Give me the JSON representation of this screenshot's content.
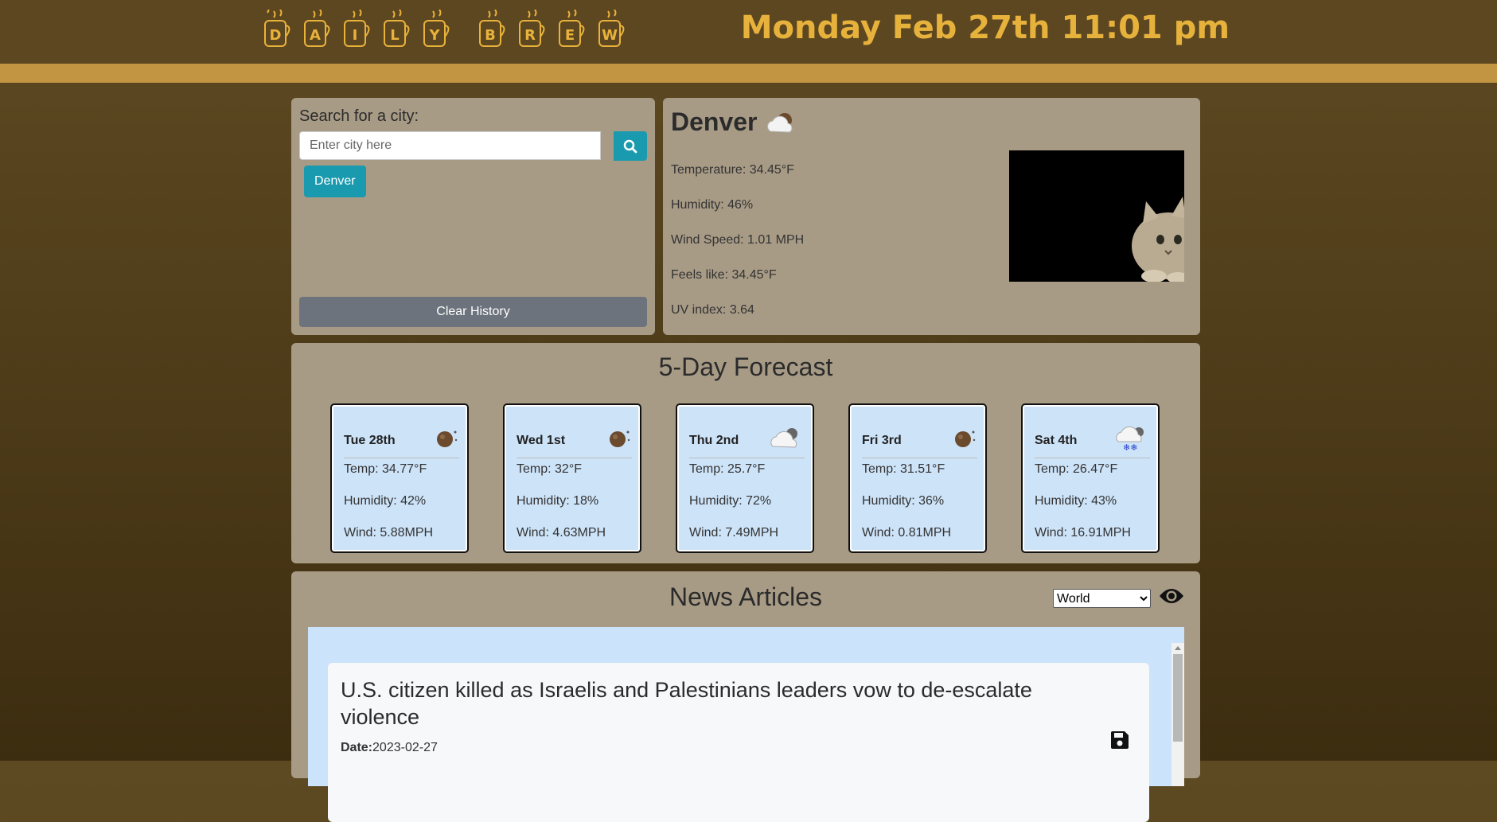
{
  "header": {
    "logo_letters": [
      "D",
      "A",
      "I",
      "L",
      "Y",
      "B",
      "R",
      "E",
      "W"
    ],
    "datetime": "Monday Feb 27th 11:01 pm"
  },
  "search": {
    "label": "Search for a city:",
    "placeholder": "Enter city here",
    "value": "",
    "history": [
      "Denver"
    ],
    "clear_label": "Clear History"
  },
  "current": {
    "city": "Denver",
    "icon": "cloud-sun-icon",
    "temperature": "Temperature: 34.45°F",
    "humidity": "Humidity: 46%",
    "wind": "Wind Speed: 1.01 MPH",
    "feels_like": "Feels like: 34.45°F",
    "uv": "UV index: 3.64"
  },
  "forecast": {
    "title": "5-Day Forecast",
    "days": [
      {
        "day": "Tue 28th",
        "icon": "moon-icon",
        "temp": "Temp: 34.77°F",
        "humidity": "Humidity: 42%",
        "wind": "Wind: 5.88MPH"
      },
      {
        "day": "Wed 1st",
        "icon": "moon-icon",
        "temp": "Temp: 32°F",
        "humidity": "Humidity: 18%",
        "wind": "Wind: 4.63MPH"
      },
      {
        "day": "Thu 2nd",
        "icon": "cloud-icon",
        "temp": "Temp: 25.7°F",
        "humidity": "Humidity: 72%",
        "wind": "Wind: 7.49MPH"
      },
      {
        "day": "Fri 3rd",
        "icon": "moon-icon",
        "temp": "Temp: 31.51°F",
        "humidity": "Humidity: 36%",
        "wind": "Wind: 0.81MPH"
      },
      {
        "day": "Sat 4th",
        "icon": "snow-icon",
        "temp": "Temp: 26.47°F",
        "humidity": "Humidity: 43%",
        "wind": "Wind: 16.91MPH"
      }
    ]
  },
  "news": {
    "title": "News Articles",
    "category": "World",
    "article": {
      "title": "U.S. citizen killed as Israelis and Palestinians leaders vow to de-escalate violence",
      "date_label": "Date:",
      "date": "2023-02-27"
    }
  },
  "colors": {
    "accent": "#e7b23c",
    "stripe": "#c19542",
    "button": "#1a9aae",
    "panel": "#a89b86",
    "card": "#cde3f8"
  }
}
